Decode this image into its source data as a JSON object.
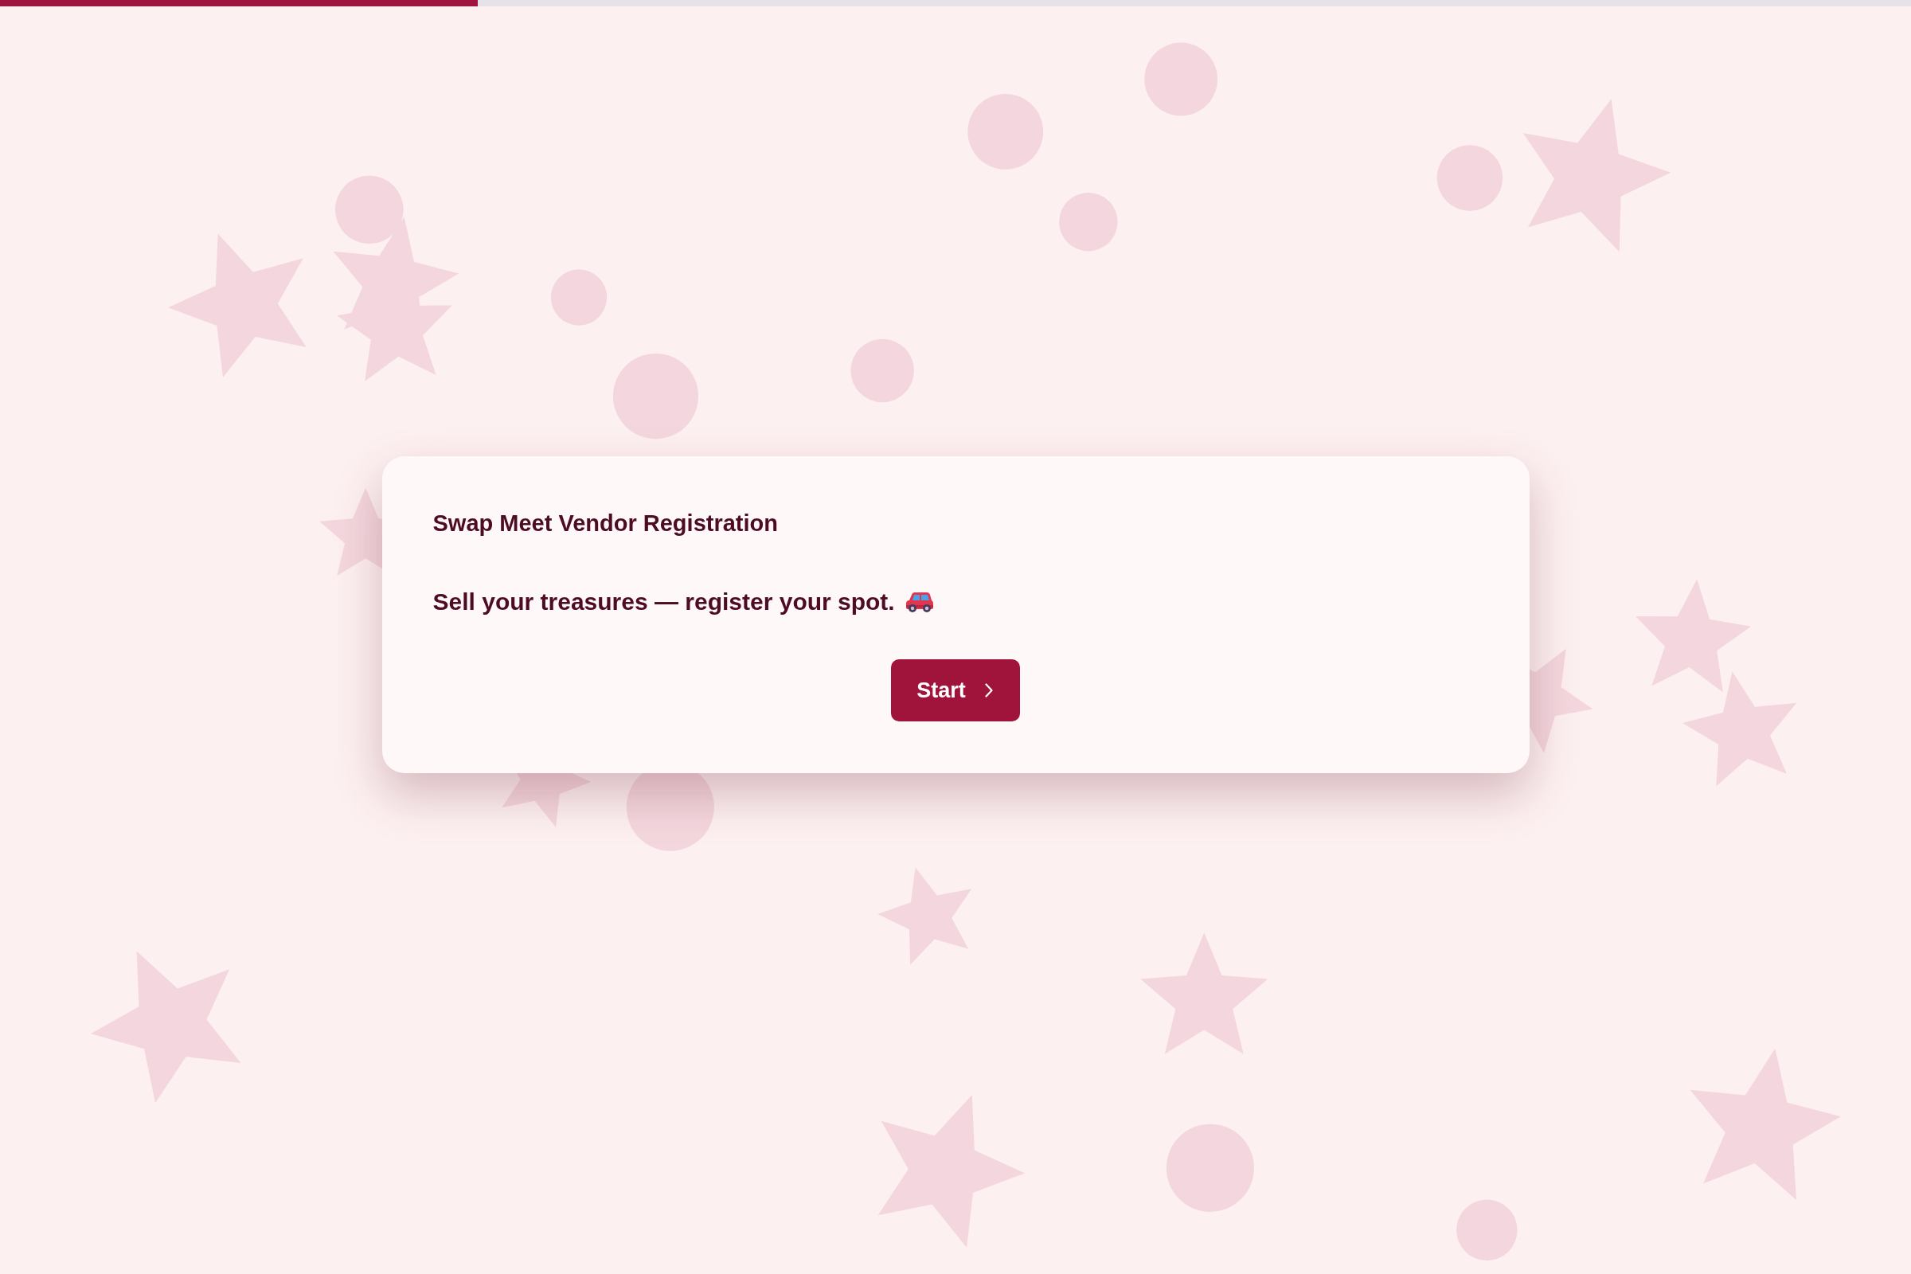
{
  "progress": {
    "level": 0.25
  },
  "card": {
    "title": "Swap Meet Vendor Registration",
    "subtitle": "Sell your treasures — register your spot.",
    "start_button": {
      "label": "Start"
    }
  }
}
